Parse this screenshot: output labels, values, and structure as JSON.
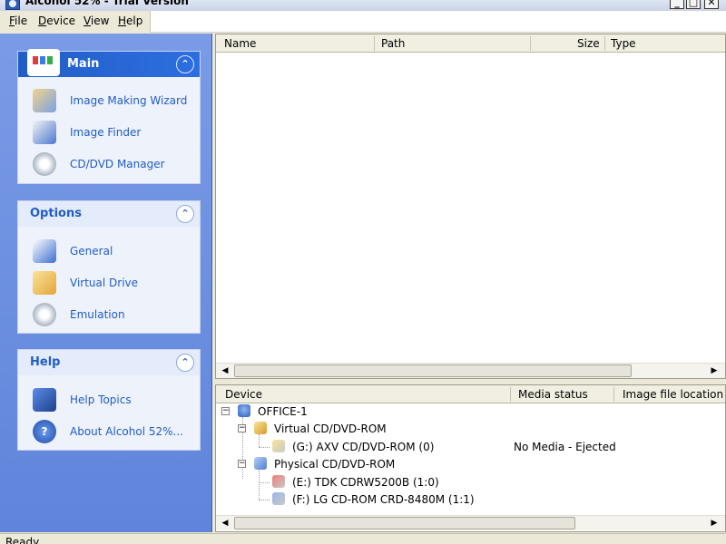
{
  "window": {
    "title": "Alcohol 52% - Trial Version",
    "controls": {
      "minimize": "_",
      "maximize": "□",
      "close": "✕"
    }
  },
  "menubar": {
    "items": [
      {
        "label": "File",
        "underline": "F",
        "rest": "ile"
      },
      {
        "label": "Device",
        "underline": "D",
        "rest": "evice"
      },
      {
        "label": "View",
        "underline": "V",
        "rest": "iew"
      },
      {
        "label": "Help",
        "underline": "H",
        "rest": "elp"
      }
    ]
  },
  "sidebar": {
    "main": {
      "title": "Main",
      "collapse_glyph": "⌃",
      "items": [
        {
          "label": "Image Making Wizard",
          "icon": "wizard-icon"
        },
        {
          "label": "Image Finder",
          "icon": "finder-icon"
        },
        {
          "label": "CD/DVD Manager",
          "icon": "manager-icon"
        }
      ]
    },
    "options": {
      "title": "Options",
      "collapse_glyph": "⌃",
      "items": [
        {
          "label": "General",
          "icon": "general-icon"
        },
        {
          "label": "Virtual Drive",
          "icon": "virtual-drive-icon"
        },
        {
          "label": "Emulation",
          "icon": "emulation-icon"
        }
      ]
    },
    "help": {
      "title": "Help",
      "collapse_glyph": "⌃",
      "items": [
        {
          "label": "Help Topics",
          "icon": "help-topics-icon"
        },
        {
          "label": "About Alcohol 52%...",
          "icon": "about-icon"
        }
      ]
    }
  },
  "image_list": {
    "columns": [
      "Name",
      "Path",
      "Size",
      "Type"
    ],
    "rows": []
  },
  "device_list": {
    "columns": [
      "Device",
      "Media status",
      "Image file location"
    ],
    "tree": {
      "root": "OFFICE-1",
      "virtual_group": "Virtual CD/DVD-ROM",
      "virtual_drive": {
        "label": "(G:) AXV CD/DVD-ROM (0)",
        "status": "No Media - Ejected"
      },
      "physical_group": "Physical CD/DVD-ROM",
      "physical_drives": [
        {
          "label": "(E:) TDK CDRW5200B (1:0)",
          "status": ""
        },
        {
          "label": "(F:) LG CD-ROM CRD-8480M (1:1)",
          "status": ""
        }
      ]
    }
  },
  "statusbar": {
    "text": "Ready"
  },
  "colors": {
    "sidebar": "#6b8fe0",
    "panel_header_main": "#215dc6",
    "panel_link": "#215dc6"
  }
}
